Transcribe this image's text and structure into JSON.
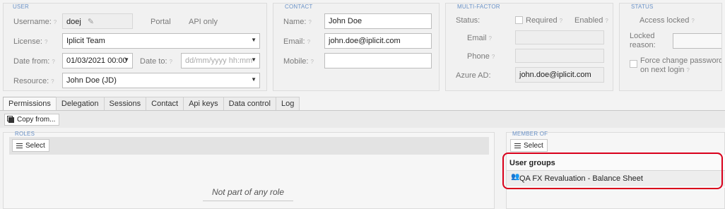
{
  "user": {
    "legend": "USER",
    "username_label": "Username:",
    "username_value": "doej",
    "portal_label": "Portal",
    "api_only_label": "API only",
    "license_label": "License:",
    "license_value": "Iplicit Team",
    "date_from_label": "Date from:",
    "date_from_value": "01/03/2021 00:00",
    "date_to_label": "Date to:",
    "date_to_placeholder": "dd/mm/yyyy hh:mm",
    "resource_label": "Resource:",
    "resource_value": "John Doe (JD)"
  },
  "contact": {
    "legend": "CONTACT",
    "name_label": "Name:",
    "name_value": "John Doe",
    "email_label": "Email:",
    "email_value": "john.doe@iplicit.com",
    "mobile_label": "Mobile:",
    "mobile_value": ""
  },
  "mfa": {
    "legend": "MULTI-FACTOR",
    "status_label": "Status:",
    "required_label": "Required",
    "enabled_label": "Enabled",
    "email_label": "Email",
    "phone_label": "Phone",
    "azure_label": "Azure AD:",
    "azure_value": "john.doe@iplicit.com"
  },
  "status": {
    "legend": "STATUS",
    "access_locked_label": "Access locked",
    "locked_reason_label_1": "Locked",
    "locked_reason_label_2": "reason:",
    "force_change_label_1": "Force change password",
    "force_change_label_2": "on next login"
  },
  "tabs": [
    "Permissions",
    "Delegation",
    "Sessions",
    "Contact",
    "Api keys",
    "Data control",
    "Log"
  ],
  "copy_from_label": "Copy from...",
  "roles": {
    "legend": "ROLES",
    "select_label": "Select",
    "empty_text": "Not part of any role"
  },
  "member_of": {
    "legend": "MEMBER OF",
    "select_label": "Select",
    "header": "User groups",
    "items": [
      "QA FX Revaluation - Balance Sheet"
    ]
  },
  "colors": {
    "legend": "#6a92c7",
    "highlight": "#d9001b"
  }
}
